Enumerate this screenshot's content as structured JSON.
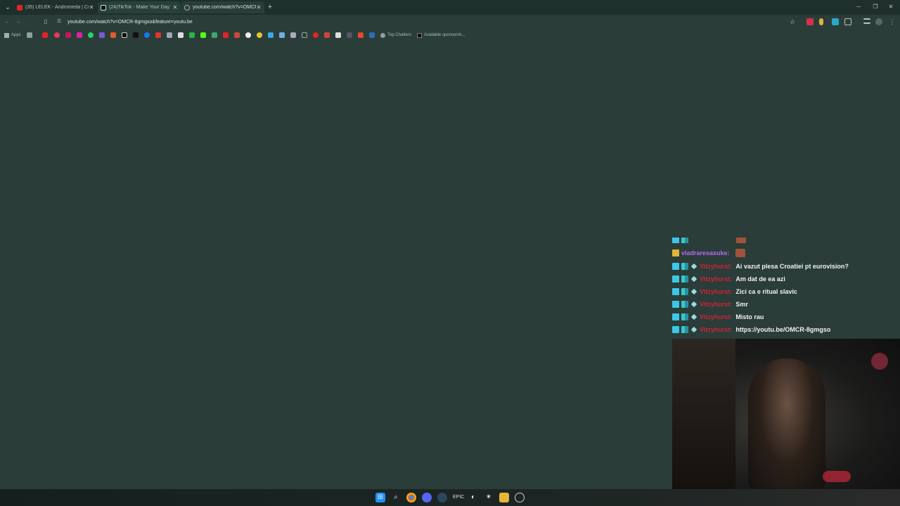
{
  "tabs": [
    {
      "title": "(35) LELEK - Andromeda | Croati",
      "favicon": "youtube-icon",
      "color": "#e02424"
    },
    {
      "title": "(24)TikTok - Make Your Day",
      "favicon": "tiktok-icon",
      "color": "#111111"
    },
    {
      "title": "youtube.com/watch?v=OMCR-",
      "favicon": "globe-icon",
      "color": "#9fb0ab"
    }
  ],
  "address_bar": {
    "url": "youtube.com/watch?v=OMCR-8gmgso&feature=youtu.be"
  },
  "bookmarks": {
    "apps_label": "Apps",
    "top_chatters": "Top Chatters",
    "available_sponsorship": "Available sponsorsh..."
  },
  "chat": {
    "partial_user": "",
    "messages": [
      {
        "user": "vladraresasuke:",
        "text": "",
        "user_color": "#b36cf0"
      },
      {
        "user": "Vitzyhurst:",
        "text": "Ai vazut plesa Croatiei pt eurovision?"
      },
      {
        "user": "Vitzyhurst:",
        "text": "Am dat de ea azi"
      },
      {
        "user": "Vitzyhurst:",
        "text": "Zici ca e ritual slavic"
      },
      {
        "user": "Vitzyhurst:",
        "text": "Smr"
      },
      {
        "user": "Vitzyhurst:",
        "text": "Misto rau"
      },
      {
        "user": "Vitzyhurst:",
        "text": "https://youtu.be/OMCR-8gmgso"
      }
    ]
  },
  "colors": {
    "background": "#2a3d38",
    "username": "#d0223a",
    "accent": "#3ec6ea"
  }
}
